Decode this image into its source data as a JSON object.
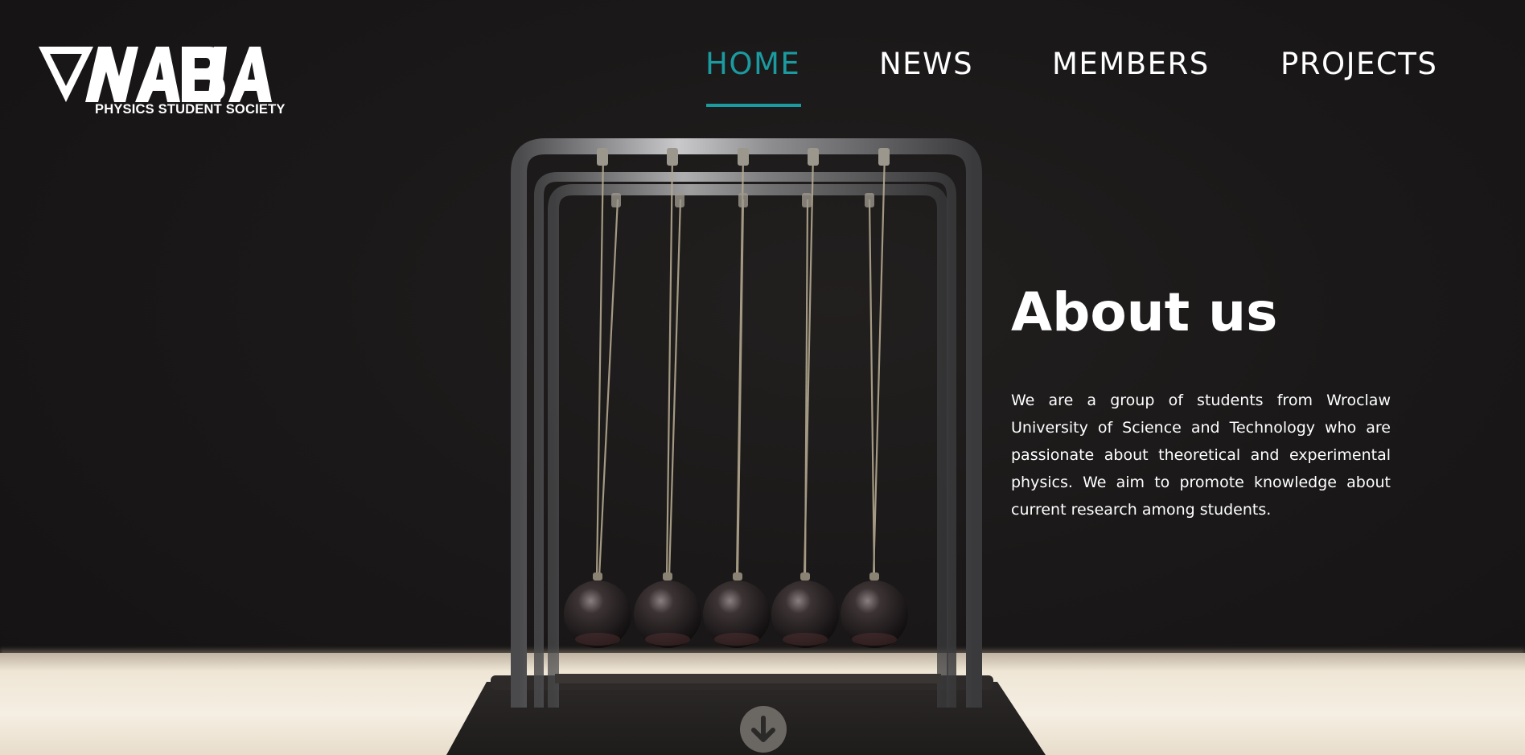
{
  "brand": {
    "logo_text": "VNABLA",
    "subtitle": "PHYSICS STUDENT SOCIETY"
  },
  "nav": {
    "items": [
      {
        "label": "HOME",
        "active": true
      },
      {
        "label": "NEWS",
        "active": false
      },
      {
        "label": "MEMBERS",
        "active": false
      },
      {
        "label": "PROJECTS",
        "active": false
      }
    ],
    "active_color": "#1b9aa0"
  },
  "about": {
    "title": "About us",
    "body": "We are a group of students from Wroclaw University of Science and Technology who are passionate about theoretical and experimental physics. We aim to promote knowledge about current research among students."
  },
  "hero_image": {
    "subject": "Newton's cradle"
  },
  "scroll_button": {
    "icon": "arrow-down-icon"
  }
}
